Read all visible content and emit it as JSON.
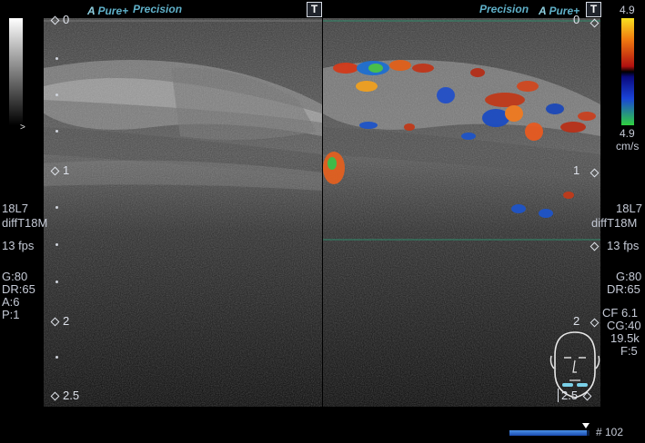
{
  "header": {
    "left_brand": "Pure",
    "left_brand_prefix": "A",
    "left_mode": "Precision",
    "right_mode": "Precision",
    "right_brand_prefix": "A",
    "right_brand": "Pure",
    "transducer_mark": "T"
  },
  "depth_scale": {
    "left_labels": [
      "0",
      "1",
      "2",
      "2.5"
    ],
    "right_labels": [
      "0",
      "1",
      "2",
      "2.5"
    ]
  },
  "left_params": {
    "probe": "18L7",
    "preset": "diffT18M",
    "fps": "13 fps",
    "gain": "G:80",
    "dynamic_range": "DR:65",
    "a_value": "A:6",
    "p_value": "P:1"
  },
  "right_params": {
    "probe": "18L7",
    "preset": "diffT18M",
    "fps": "13 fps",
    "gain": "G:80",
    "dynamic_range": "DR:65",
    "cf": "CF 6.1",
    "cg": "CG:40",
    "prf": "19.5k",
    "filter": "F:5"
  },
  "color_bar": {
    "top_value": "4.9",
    "bottom_value": "4.9",
    "unit": "cm/s"
  },
  "footer": {
    "frame_number": "# 102",
    "cine_progress": 0.97
  }
}
